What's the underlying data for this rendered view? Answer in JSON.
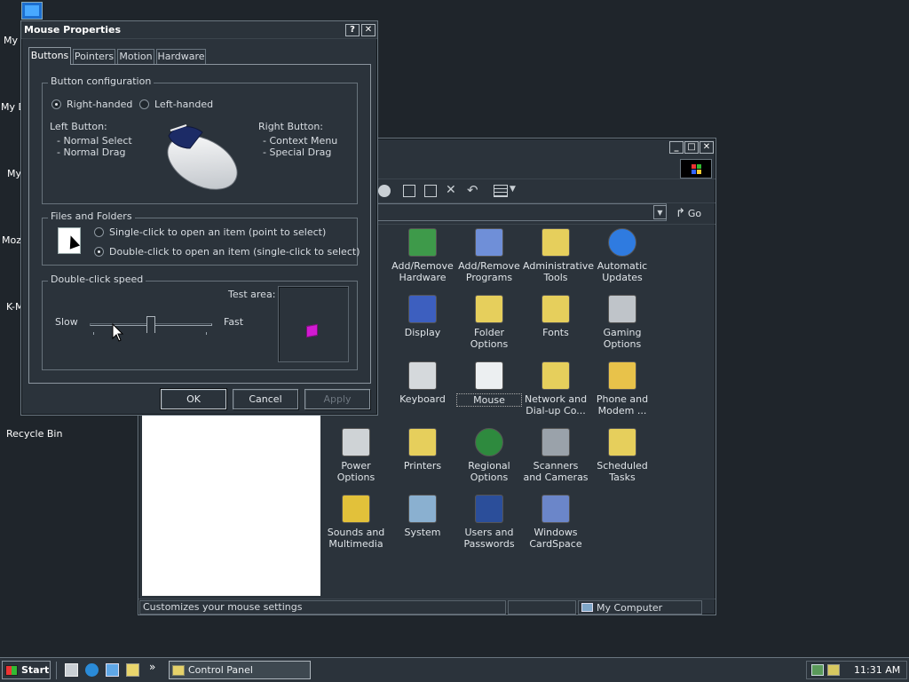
{
  "desktop": {
    "labels": [
      "My",
      "My D",
      "My",
      "Moz",
      "K-M"
    ],
    "recycle_bin": "Recycle Bin"
  },
  "mouse_dialog": {
    "title": "Mouse Properties",
    "help_btn": "?",
    "close_btn": "✕",
    "tabs": [
      "Buttons",
      "Pointers",
      "Motion",
      "Hardware"
    ],
    "button_config": {
      "title": "Button configuration",
      "right_handed": "Right-handed",
      "left_handed": "Left-handed",
      "left_button_heading": "Left Button:",
      "left_items": [
        "-  Normal Select",
        "-  Normal Drag"
      ],
      "right_button_heading": "Right Button:",
      "right_items": [
        "-  Context Menu",
        "-  Special Drag"
      ]
    },
    "files_folders": {
      "title": "Files and Folders",
      "single_click": "Single-click to open an item (point to select)",
      "double_click": "Double-click to open an item (single-click to select)"
    },
    "double_click_speed": {
      "title": "Double-click speed",
      "test_area": "Test area:",
      "slow": "Slow",
      "fast": "Fast",
      "level": 0.5
    },
    "ok": "OK",
    "cancel": "Cancel",
    "apply": "Apply"
  },
  "control_panel": {
    "min_btn": "_",
    "max_btn": "□",
    "close_btn": "✕",
    "go_label": "Go",
    "icons": [
      {
        "label": "Add/Remove Hardware",
        "icon": "hardware-icon"
      },
      {
        "label": "Add/Remove Programs",
        "icon": "programs-icon"
      },
      {
        "label": "Administrative Tools",
        "icon": "admin-tools-icon"
      },
      {
        "label": "Automatic Updates",
        "icon": "updates-icon"
      },
      {
        "label": "Display",
        "icon": "display-icon"
      },
      {
        "label": "Folder Options",
        "icon": "folder-options-icon"
      },
      {
        "label": "Fonts",
        "icon": "fonts-icon"
      },
      {
        "label": "Gaming Options",
        "icon": "gaming-icon"
      },
      {
        "label": "Keyboard",
        "icon": "keyboard-icon"
      },
      {
        "label": "Mouse",
        "icon": "mouse-icon"
      },
      {
        "label": "Network and Dial-up Co...",
        "icon": "network-icon"
      },
      {
        "label": "Phone and Modem ...",
        "icon": "phone-icon"
      },
      {
        "label": "Power Options",
        "icon": "power-icon"
      },
      {
        "label": "Printers",
        "icon": "printers-icon"
      },
      {
        "label": "Regional Options",
        "icon": "regional-icon"
      },
      {
        "label": "Scanners and Cameras",
        "icon": "scanners-icon"
      },
      {
        "label": "Scheduled Tasks",
        "icon": "tasks-icon"
      },
      {
        "label": "Sounds and Multimedia",
        "icon": "sounds-icon"
      },
      {
        "label": "System",
        "icon": "system-icon"
      },
      {
        "label": "Users and Passwords",
        "icon": "users-icon"
      },
      {
        "label": "Windows CardSpace",
        "icon": "cardspace-icon"
      }
    ],
    "status_text": "Customizes your mouse settings",
    "status_zone": "My Computer"
  },
  "taskbar": {
    "start": "Start",
    "active_task": "Control Panel",
    "chevron": "»",
    "clock": "11:31 AM"
  }
}
